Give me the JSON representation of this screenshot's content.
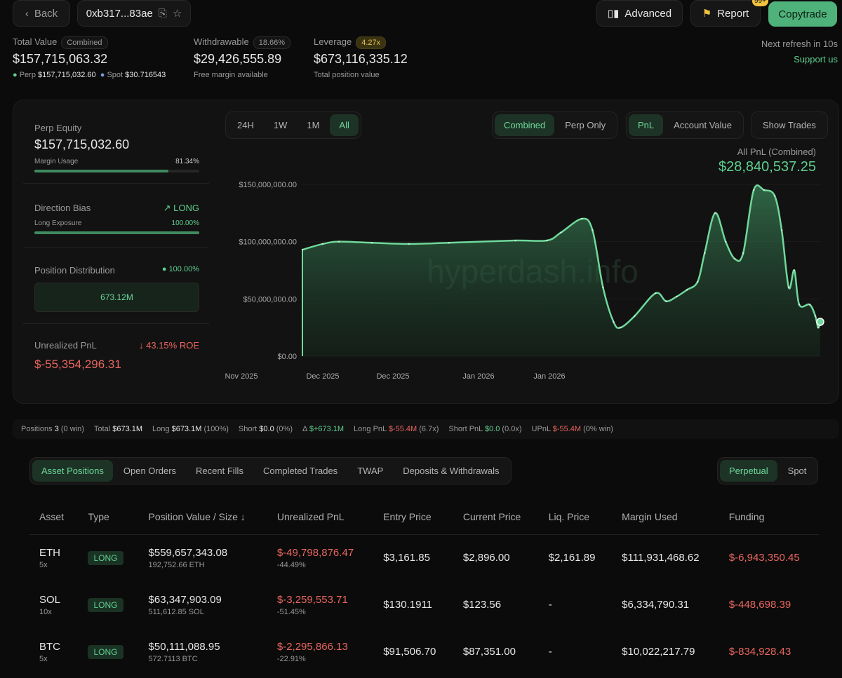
{
  "header": {
    "back": "Back",
    "address": "0xb317...83ae",
    "advanced": "Advanced",
    "report": "Report",
    "report_badge": "99+",
    "copytrade": "Copytrade",
    "refresh": "Next refresh in 10s",
    "support": "Support us"
  },
  "summary": {
    "total_label": "Total Value",
    "total_pill": "Combined",
    "total_value": "$157,715,063.32",
    "perp_label": "Perp",
    "perp_value": "$157,715,032.60",
    "spot_label": "Spot",
    "spot_value": "$30.716543",
    "withdrawable_label": "Withdrawable",
    "withdrawable_pill": "18.66%",
    "withdrawable_value": "$29,426,555.89",
    "withdrawable_sub": "Free margin available",
    "leverage_label": "Leverage",
    "leverage_pill": "4.27x",
    "leverage_value": "$673,116,335.12",
    "leverage_sub": "Total position value"
  },
  "left": {
    "equity_label": "Perp Equity",
    "equity_value": "$157,715,032.60",
    "margin_label": "Margin Usage",
    "margin_value": "81.34%",
    "margin_pct": 81.34,
    "bias_label": "Direction Bias",
    "bias_value": "LONG",
    "exposure_label": "Long Exposure",
    "exposure_value": "100.00%",
    "exposure_pct": 100,
    "dist_label": "Position Distribution",
    "dist_value": "100.00%",
    "dist_box": "673.12M",
    "upnl_label": "Unrealized PnL",
    "roe": "43.15% ROE",
    "upnl_value": "$-55,354,296.31"
  },
  "controls": {
    "ranges": [
      "24H",
      "1W",
      "1M",
      "All"
    ],
    "modes": [
      "Combined",
      "Perp Only"
    ],
    "metrics": [
      "PnL",
      "Account Value"
    ],
    "show_trades": "Show Trades"
  },
  "chart_data": {
    "type": "area",
    "title": "All PnL (Combined)",
    "headline": "$28,840,537.25",
    "watermark": "hyperdash.info",
    "ylim": [
      0,
      150000000
    ],
    "yticks": [
      "$0.00",
      "$50,000,000.00",
      "$100,000,000.00",
      "$150,000,000.00"
    ],
    "xticks": [
      "Nov 2025",
      "Nov 2025",
      "Dec 2025",
      "Dec 2025",
      "Jan 2026",
      "Jan 2026"
    ],
    "x": [
      0,
      29,
      52,
      99,
      152,
      209,
      304,
      349,
      369,
      399,
      414,
      429,
      444,
      454,
      474,
      504,
      519,
      534,
      549,
      564,
      574,
      589,
      604,
      617,
      629,
      644,
      659,
      674,
      684,
      694,
      702,
      709,
      724,
      732,
      736,
      739
    ],
    "y": [
      93,
      98,
      100,
      99,
      98,
      99,
      101,
      101,
      108,
      120,
      110,
      60,
      30,
      25,
      35,
      55,
      48,
      52,
      58,
      65,
      90,
      125,
      100,
      85,
      90,
      145,
      145,
      140,
      110,
      60,
      75,
      45,
      45,
      35,
      25,
      30
    ]
  },
  "stats": {
    "positions_label": "Positions",
    "positions": "3",
    "positions_sub": "(0 win)",
    "total_label": "Total",
    "total": "$673.1M",
    "long_label": "Long",
    "long": "$673.1M",
    "long_sub": "(100%)",
    "short_label": "Short",
    "short": "$0.0",
    "short_sub": "(0%)",
    "delta_label": "Δ",
    "delta": "$+673.1M",
    "lpnl_label": "Long PnL",
    "lpnl": "$-55.4M",
    "lpnl_sub": "(6.7x)",
    "spnl_label": "Short PnL",
    "spnl": "$0.0",
    "spnl_sub": "(0.0x)",
    "upnl_label": "UPnL",
    "upnl": "$-55.4M",
    "upnl_sub": "(0% win)"
  },
  "tabs": [
    "Asset Positions",
    "Open Orders",
    "Recent Fills",
    "Completed Trades",
    "TWAP",
    "Deposits & Withdrawals"
  ],
  "market_tabs": [
    "Perpetual",
    "Spot"
  ],
  "table": {
    "headers": [
      "Asset",
      "Type",
      "Position Value / Size ↓",
      "Unrealized PnL",
      "Entry Price",
      "Current Price",
      "Liq. Price",
      "Margin Used",
      "Funding"
    ],
    "rows": [
      {
        "asset": "ETH",
        "lev": "5x",
        "type": "LONG",
        "value": "$559,657,343.08",
        "size": "192,752.66 ETH",
        "pnl": "$-49,798,876.47",
        "pnl_pct": "-44.49%",
        "entry": "$3,161.85",
        "current": "$2,896.00",
        "liq": "$2,161.89",
        "margin": "$111,931,468.62",
        "funding": "$-6,943,350.45"
      },
      {
        "asset": "SOL",
        "lev": "10x",
        "type": "LONG",
        "value": "$63,347,903.09",
        "size": "511,612.85 SOL",
        "pnl": "$-3,259,553.71",
        "pnl_pct": "-51.45%",
        "entry": "$130.1911",
        "current": "$123.56",
        "liq": "-",
        "margin": "$6,334,790.31",
        "funding": "$-448,698.39"
      },
      {
        "asset": "BTC",
        "lev": "5x",
        "type": "LONG",
        "value": "$50,111,088.95",
        "size": "572.7113 BTC",
        "pnl": "$-2,295,866.13",
        "pnl_pct": "-22.91%",
        "entry": "$91,506.70",
        "current": "$87,351.00",
        "liq": "-",
        "margin": "$10,022,217.79",
        "funding": "$-834,928.43"
      }
    ]
  }
}
